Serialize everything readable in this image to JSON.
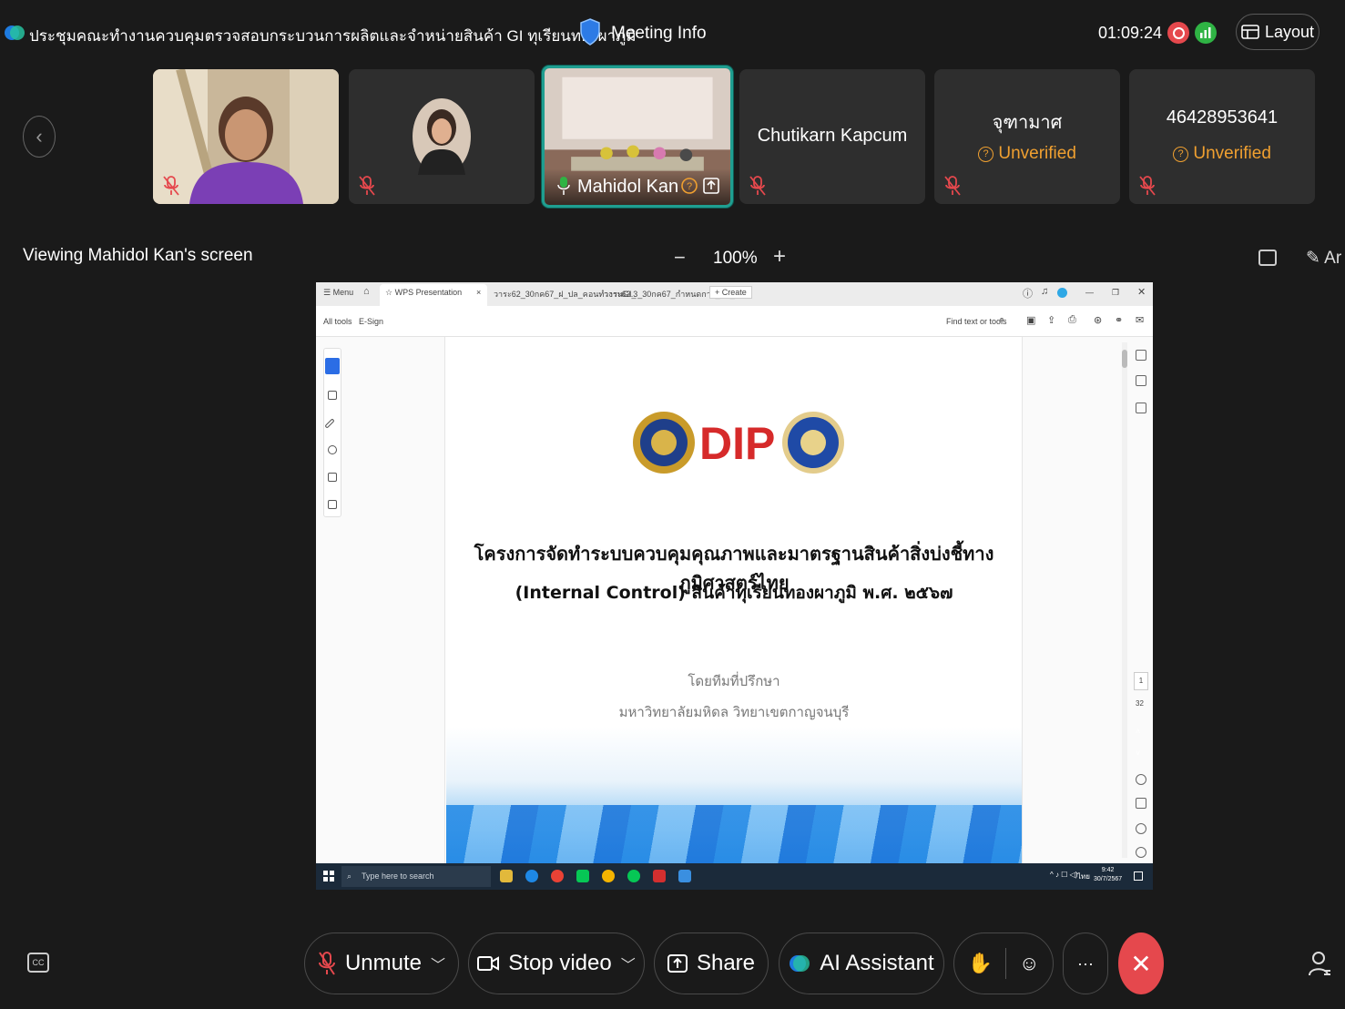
{
  "top_bar": {
    "meeting_title": "ประชุมคณะทำงานควบคุมตรวจสอบกระบวนการผลิตและจำหน่ายสินค้า GI ทุเรียนทองผาภูมิ",
    "meeting_info_label": "Meeting Info",
    "elapsed_time": "01:09:24",
    "layout_label": "Layout"
  },
  "participants": [
    {
      "name": "",
      "type": "camera",
      "muted": true
    },
    {
      "name": "",
      "type": "avatar",
      "muted": true
    },
    {
      "name": "Mahidol Kan",
      "type": "screen",
      "muted": false,
      "active": true
    },
    {
      "name": "Chutikarn Kapcum",
      "muted": true
    },
    {
      "name": "จุฑามาศ",
      "status": "Unverified",
      "muted": true
    },
    {
      "name": "46428953641",
      "status": "Unverified",
      "muted": true
    }
  ],
  "viewing_bar": {
    "viewing_label": "Viewing Mahidol Kan's screen",
    "zoom_minus": "−",
    "zoom_level": "100%",
    "zoom_plus": "+",
    "annotate_label": "Ar"
  },
  "shared_screen": {
    "tabs": {
      "menu": "Menu",
      "tab1": "WPS Presentation",
      "tab2": "วาระ62_30กค67_ฝ_ปล_คอนทำงานGI_",
      "tab3": "วาระ63.3_30กค67_กำหนดการ_ปล_ทก...",
      "create": "Create"
    },
    "toolbar": {
      "all_tools": "All tools",
      "esign": "E-Sign",
      "find": "Find text or tools"
    },
    "document": {
      "logo_text": "DIP",
      "title_line1": "โครงการจัดทำระบบควบคุมคุณภาพและมาตรฐานสินค้าสิ่งบ่งชี้ทางภูมิศาสตร์ไทย",
      "title_line2": "(Internal Control) สินค้าทุเรียนทองผาภูมิ พ.ศ. ๒๕๖๗",
      "subtitle1": "โดยทีมที่ปรึกษา",
      "subtitle2": "มหาวิทยาลัยมหิดล วิทยาเขตกาญจนบุรี"
    },
    "page_current": "1",
    "page_total": "32",
    "taskbar": {
      "search_placeholder": "Type here to search",
      "time": "9:42",
      "date": "30/7/2567",
      "lang": "ไทย"
    }
  },
  "controls": {
    "unmute": "Unmute",
    "stop_video": "Stop video",
    "share": "Share",
    "ai_assistant": "AI Assistant",
    "more": "···",
    "leave": "✕"
  }
}
